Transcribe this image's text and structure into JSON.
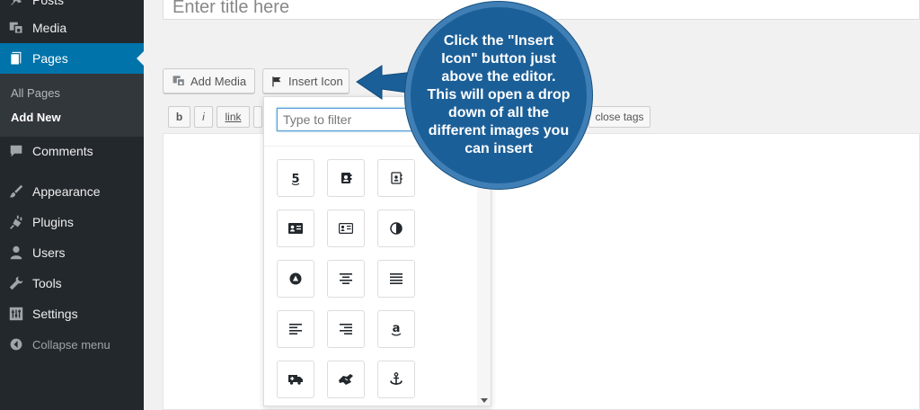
{
  "sidebar": {
    "items": [
      {
        "label": "Posts",
        "icon": "pin-icon"
      },
      {
        "label": "Media",
        "icon": "media-icon"
      },
      {
        "label": "Pages",
        "icon": "pages-icon",
        "active": true
      },
      {
        "label": "Comments",
        "icon": "comments-icon"
      },
      {
        "label": "Appearance",
        "icon": "brush-icon"
      },
      {
        "label": "Plugins",
        "icon": "plugin-icon"
      },
      {
        "label": "Users",
        "icon": "users-icon"
      },
      {
        "label": "Tools",
        "icon": "wrench-icon"
      },
      {
        "label": "Settings",
        "icon": "settings-icon"
      }
    ],
    "submenu": [
      "All Pages",
      "Add New"
    ],
    "collapse_label": "Collapse menu"
  },
  "editor": {
    "title_placeholder": "Enter title here",
    "add_media_label": "Add Media",
    "insert_icon_label": "Insert Icon",
    "quicktags": [
      "b",
      "i",
      "link"
    ],
    "close_tags_label": "close tags"
  },
  "dropdown": {
    "filter_placeholder": "Type to filter",
    "icons": [
      "500px-icon",
      "address-book-icon",
      "address-book-outline-icon",
      "address-card-icon",
      "address-card-outline-icon",
      "adjust-icon",
      "adn-icon",
      "align-center-icon",
      "align-justify-icon",
      "align-left-icon",
      "align-right-icon",
      "amazon-icon",
      "ambulance-icon",
      "american-sign-language-icon",
      "anchor-icon"
    ]
  },
  "callout": {
    "text": "Click the \"Insert Icon\" button just above the editor. This will open a drop down of all the different images you can insert"
  },
  "colors": {
    "sidebar_bg": "#23282d",
    "accent": "#0073aa",
    "callout_bg": "#1b5f98"
  }
}
